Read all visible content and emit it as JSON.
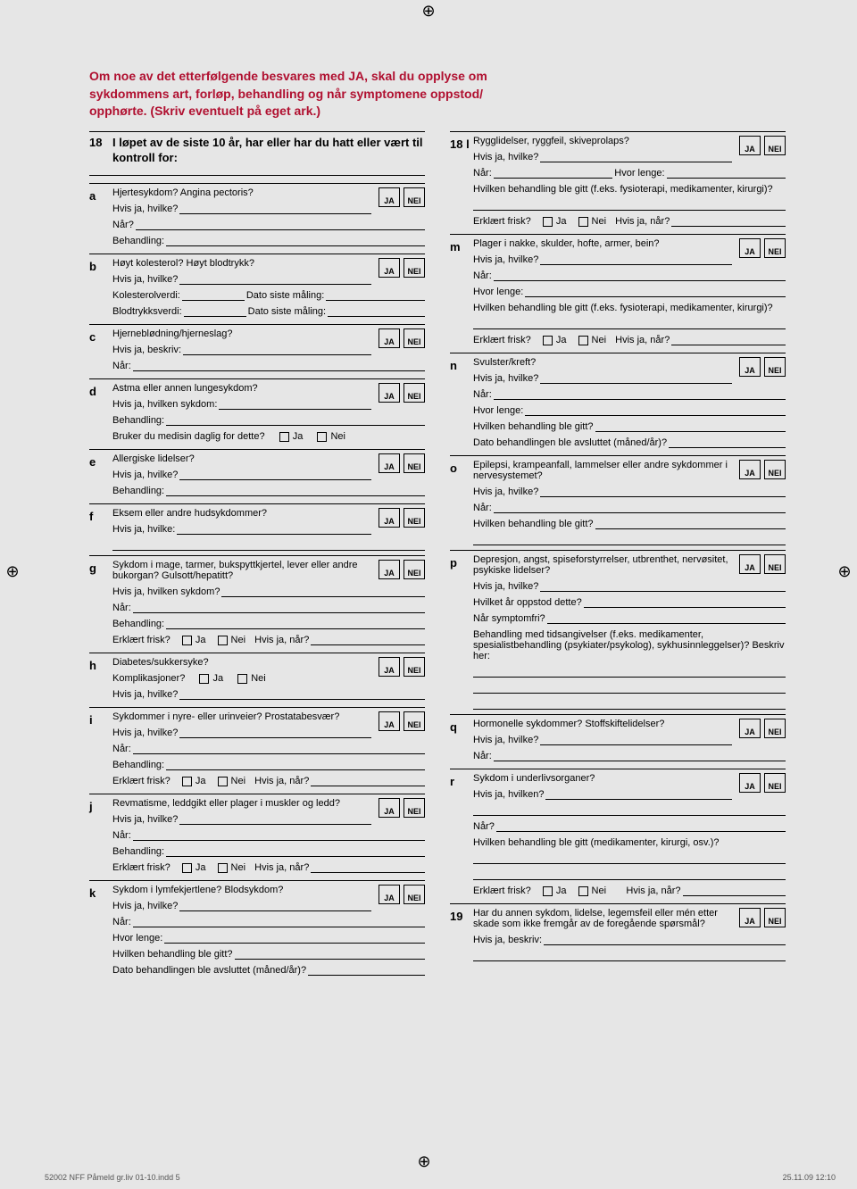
{
  "intro": {
    "line1": "Om noe av det etterfølgende besvares med JA, skal du opplyse om",
    "line2": "sykdommens art, forløp, behandling og når symptomene oppstod/",
    "line3": "opphørte. (Skriv eventuelt på eget ark.)"
  },
  "ja": "JA",
  "nei": "NEI",
  "smja": "Ja",
  "smnei": "Nei",
  "q18": {
    "num": "18",
    "text": "I løpet av de siste 10 år, har eller har du hatt eller vært til kontroll for:"
  },
  "items": {
    "a": {
      "q": "Hjertesykdom? Angina pectoris?",
      "f1": "Hvis ja, hvilke?",
      "f2": "Når?",
      "f3": "Behandling:"
    },
    "b": {
      "q": "Høyt kolesterol? Høyt blodtrykk?",
      "f1": "Hvis ja, hvilke?",
      "f2a": "Kolesterolverdi:",
      "f2b": "Dato siste måling:",
      "f3a": "Blodtrykksverdi:",
      "f3b": "Dato siste måling:"
    },
    "c": {
      "q": "Hjerneblødning/hjerneslag?",
      "f1": "Hvis ja, beskriv:",
      "f2": "Når:"
    },
    "d": {
      "q": "Astma eller annen lungesykdom?",
      "f1": "Hvis ja, hvilken sykdom:",
      "f2": "Behandling:",
      "f3": "Bruker du medisin daglig for dette?"
    },
    "e": {
      "q": "Allergiske lidelser?",
      "f1": "Hvis ja, hvilke?",
      "f2": "Behandling:"
    },
    "f": {
      "q": "Eksem eller andre hudsykdommer?",
      "f1": "Hvis ja, hvilke:"
    },
    "g": {
      "q": "Sykdom i mage, tarmer, bukspyttkjertel, lever eller andre bukorgan? Gulsott/hepatitt?",
      "f1": "Hvis ja, hvilken sykdom?",
      "f2": "Når:",
      "f3": "Behandling:",
      "f4": "Erklært frisk?",
      "f5": "Hvis ja, når?"
    },
    "h": {
      "q": "Diabetes/sukkersyke?",
      "f1": "Komplikasjoner?",
      "f2": "Hvis ja, hvilke?"
    },
    "i": {
      "q": "Sykdommer i nyre- eller urinveier? Prostatabesvær?",
      "f1": "Hvis ja, hvilke?",
      "f2": "Når:",
      "f3": "Behandling:",
      "f4": "Erklært frisk?",
      "f5": "Hvis ja, når?"
    },
    "j": {
      "q": "Revmatisme, leddgikt eller plager i muskler og ledd?",
      "f1": "Hvis ja, hvilke?",
      "f2": "Når:",
      "f3": "Behandling:",
      "f4": "Erklært frisk?",
      "f5": "Hvis ja, når?"
    },
    "k": {
      "q": "Sykdom i lymfekjertlene? Blodsykdom?",
      "f1": "Hvis ja, hvilke?",
      "f2": "Når:",
      "f3": "Hvor lenge:",
      "f4": "Hvilken behandling ble gitt?",
      "f5": "Dato behandlingen ble avsluttet (måned/år)?"
    },
    "l": {
      "num": "18 l",
      "q": "Rygglidelser, ryggfeil, skiveprolaps?",
      "f1": "Hvis ja, hvilke?",
      "f2a": "Når:",
      "f2b": "Hvor lenge:",
      "f3": "Hvilken behandling ble gitt (f.eks. fysioterapi, medikamenter, kirurgi)?",
      "f4": "Erklært frisk?",
      "f5": "Hvis ja, når?"
    },
    "m": {
      "q": "Plager i nakke, skulder, hofte, armer, bein?",
      "f1": "Hvis ja, hvilke?",
      "f2": "Når:",
      "f3": "Hvor lenge:",
      "f4": "Hvilken behandling ble gitt (f.eks. fysioterapi, medikamenter, kirurgi)?",
      "f5": "Erklært frisk?",
      "f6": "Hvis ja, når?"
    },
    "n": {
      "q": "Svulster/kreft?",
      "f1": "Hvis ja, hvilke?",
      "f2": "Når:",
      "f3": "Hvor lenge:",
      "f4": "Hvilken behandling ble gitt?",
      "f5": "Dato behandlingen ble avsluttet (måned/år)?"
    },
    "o": {
      "q": "Epilepsi, krampeanfall, lammelser eller andre sykdommer i nervesystemet?",
      "f1": "Hvis ja, hvilke?",
      "f2": "Når:",
      "f3": "Hvilken behandling ble gitt?"
    },
    "p": {
      "q": "Depresjon, angst, spiseforstyrrelser, utbrenthet, nervøsitet, psykiske lidelser?",
      "f1": "Hvis ja, hvilke?",
      "f2": "Hvilket år oppstod dette?",
      "f3": "Når symptomfri?",
      "f4": "Behandling med tidsangivelser (f.eks. medikamenter, spesialistbehandling (psykiater/psykolog), sykhusinnleggelser)? Beskriv her:"
    },
    "q": {
      "q": "Hormonelle sykdommer? Stoffskiftelidelser?",
      "f1": "Hvis ja, hvilke?",
      "f2": "Når:"
    },
    "r": {
      "q": "Sykdom i underlivsorganer?",
      "f1": "Hvis ja, hvilken?",
      "f2": "Når?",
      "f3": "Hvilken behandling ble gitt (medikamenter, kirurgi, osv.)?",
      "f4": "Erklært frisk?",
      "f5": "Hvis ja, når?"
    }
  },
  "q19": {
    "num": "19",
    "q": "Har du annen sykdom, lidelse, legemsfeil eller mén etter skade som ikke fremgår av de foregående spørsmål?",
    "f1": "Hvis ja, beskriv:"
  },
  "footer": {
    "left": "52002 NFF Påmeld gr.liv 01-10.indd   5",
    "right": "25.11.09   12:10"
  }
}
